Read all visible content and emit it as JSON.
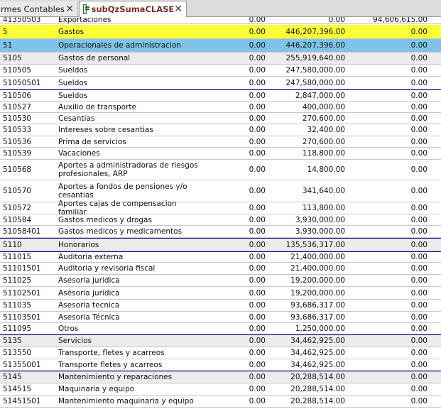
{
  "tabs": [
    {
      "label": "rmes Contables",
      "active": false
    },
    {
      "label": "subQzSumaCLASE",
      "active": true
    }
  ],
  "rows": [
    {
      "code": "41350503",
      "name": "Exportaciones",
      "a": "0.00",
      "b": "0.00",
      "c": "94,606,615.00"
    },
    {
      "code": "5",
      "name": "Gastos",
      "a": "0.00",
      "b": "446,207,396.00",
      "c": "0.00"
    },
    {
      "code": "51",
      "name": "Operacionales de administracion",
      "a": "0.00",
      "b": "446,207,396.00",
      "c": "0.00"
    },
    {
      "code": "5105",
      "name": "Gastos de personal",
      "a": "0.00",
      "b": "255,919,640.00",
      "c": "0.00"
    },
    {
      "code": "510505",
      "name": "Sueldos",
      "a": "0.00",
      "b": "247,580,000.00",
      "c": "0.00"
    },
    {
      "code": "51050501",
      "name": "Sueldos",
      "a": "0.00",
      "b": "247,580,000.00",
      "c": "0.00"
    },
    {
      "code": "510506",
      "name": "Sueldos",
      "a": "0.00",
      "b": "2,847,000.00",
      "c": "0.00"
    },
    {
      "code": "510527",
      "name": "Auxilio de transporte",
      "a": "0.00",
      "b": "400,000.00",
      "c": "0.00"
    },
    {
      "code": "510530",
      "name": "Cesantias",
      "a": "0.00",
      "b": "270,600.00",
      "c": "0.00"
    },
    {
      "code": "510533",
      "name": "Intereses sobre cesantias",
      "a": "0.00",
      "b": "32,400.00",
      "c": "0.00"
    },
    {
      "code": "510536",
      "name": "Prima de servicios",
      "a": "0.00",
      "b": "270,600.00",
      "c": "0.00"
    },
    {
      "code": "510539",
      "name": "Vacaciones",
      "a": "0.00",
      "b": "118,800.00",
      "c": "0.00"
    },
    {
      "code": "510568",
      "name": "Aportes a administradoras de riesgos profesionales, ARP",
      "a": "0.00",
      "b": "14,800.00",
      "c": "0.00"
    },
    {
      "code": "510570",
      "name": "Aportes a fondos de pensiones y/o cesantias",
      "a": "0.00",
      "b": "341,640.00",
      "c": "0.00"
    },
    {
      "code": "510572",
      "name": "Aportes cajas de compensacion familiar",
      "a": "0.00",
      "b": "113,800.00",
      "c": "0.00"
    },
    {
      "code": "510584",
      "name": "Gastos medicos y drogas",
      "a": "0.00",
      "b": "3,930,000.00",
      "c": "0.00"
    },
    {
      "code": "51058401",
      "name": "Gastos medicos y medicamentos",
      "a": "0.00",
      "b": "3,930,000.00",
      "c": "0.00"
    },
    {
      "code": "5110",
      "name": "Honorarios",
      "a": "0.00",
      "b": "135,536,317.00",
      "c": "0.00"
    },
    {
      "code": "511015",
      "name": "Auditoria externa",
      "a": "0.00",
      "b": "21,400,000.00",
      "c": "0.00"
    },
    {
      "code": "51101501",
      "name": "Auditoria y revisoria fiscal",
      "a": "0.00",
      "b": "21,400,000.00",
      "c": "0.00"
    },
    {
      "code": "511025",
      "name": "Asesoria juridica",
      "a": "0.00",
      "b": "19,200,000.00",
      "c": "0.00"
    },
    {
      "code": "51102501",
      "name": "Asésoria jurídica",
      "a": "0.00",
      "b": "19,200,000.00",
      "c": "0.00"
    },
    {
      "code": "511035",
      "name": "Asesoria tecnica",
      "a": "0.00",
      "b": "93,686,317.00",
      "c": "0.00"
    },
    {
      "code": "51103501",
      "name": "Asesoria Técnica",
      "a": "0.00",
      "b": "93,686,317.00",
      "c": "0.00"
    },
    {
      "code": "511095",
      "name": "Otros",
      "a": "0.00",
      "b": "1,250,000.00",
      "c": "0.00"
    },
    {
      "code": "5135",
      "name": "Servicios",
      "a": "0.00",
      "b": "34,462,925.00",
      "c": "0.00"
    },
    {
      "code": "513550",
      "name": "Transporte, fletes y acarreos",
      "a": "0.00",
      "b": "34,462,925.00",
      "c": "0.00"
    },
    {
      "code": "51355001",
      "name": "Transporte fletes y acarreos",
      "a": "0.00",
      "b": "34,462,925.00",
      "c": "0.00"
    },
    {
      "code": "5145",
      "name": "Mantenimiento y reparaciones",
      "a": "0.00",
      "b": "20,288,514.00",
      "c": "0.00"
    },
    {
      "code": "514515",
      "name": "Maquinaria y equipo",
      "a": "0.00",
      "b": "20,288,514.00",
      "c": "0.00"
    },
    {
      "code": "51451501",
      "name": "Mantenimiento maquinaria y equipo",
      "a": "0.00",
      "b": "20,288,514.00",
      "c": "0.00"
    }
  ]
}
